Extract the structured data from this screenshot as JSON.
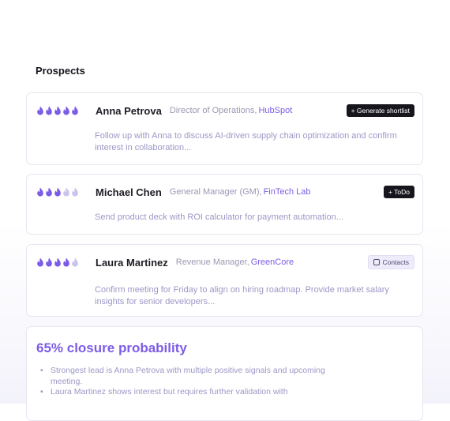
{
  "section_title": "Prospects",
  "colors": {
    "flame_active": "#7c5ce6",
    "flame_inactive": "#c9c4ec",
    "accent": "#7c5ce6"
  },
  "prospects": [
    {
      "rating": 5,
      "name": "Anna Petrova",
      "role": "Director of Operations,",
      "company": "HubSpot",
      "action": "+ Generate shortlist",
      "note": "Follow up with Anna to discuss AI-driven supply chain optimization and confirm interest in collaboration..."
    },
    {
      "rating": 3,
      "name": "Michael Chen",
      "role": "General Manager (GM),",
      "company": "FinTech Lab",
      "action": "+ ToDo",
      "note": "Send product deck with ROI calculator for payment automation..."
    },
    {
      "rating": 4,
      "name": "Laura Martinez",
      "role": "Revenue Manager,",
      "company": "GreenCore",
      "action": "Contacts",
      "action_icon": "contacts-icon",
      "note": "Confirm meeting for Friday to align on hiring roadmap. Provide market salary insights for senior developers..."
    }
  ],
  "probability": {
    "title": "65% closure probability",
    "points": [
      "Strongest lead is Anna Petrova with multiple positive signals and upcoming meeting.",
      "Laura Martinez shows interest but requires further validation with"
    ]
  }
}
